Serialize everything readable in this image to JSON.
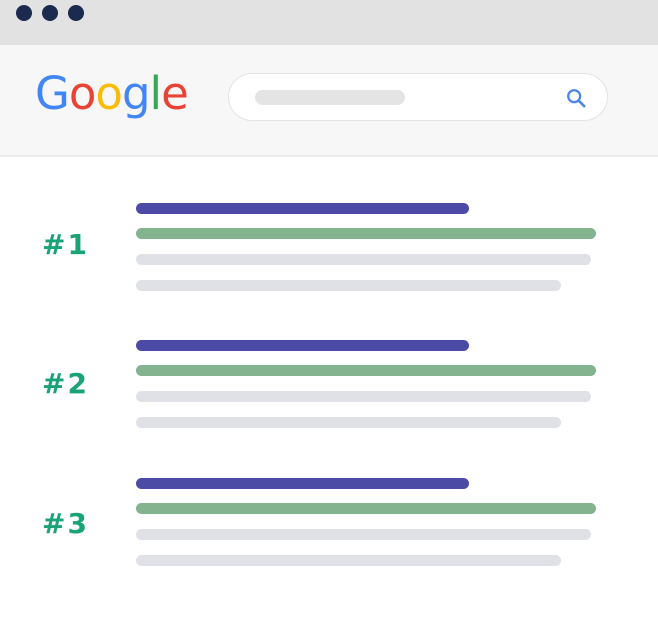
{
  "window": {
    "traffic_lights": [
      "dot",
      "dot",
      "dot"
    ],
    "dot_color": "#1b2a4e",
    "titlebar_color": "#e2e2e2"
  },
  "header": {
    "logo": {
      "letters": [
        "G",
        "o",
        "o",
        "g",
        "l",
        "e"
      ],
      "colors": [
        "#4285F4",
        "#EA4335",
        "#FBBC05",
        "#4285F4",
        "#34A853",
        "#EA4335"
      ]
    },
    "search": {
      "icon": "search-icon",
      "icon_color": "#4a86e8"
    }
  },
  "results": [
    {
      "rank": "#1"
    },
    {
      "rank": "#2"
    },
    {
      "rank": "#3"
    }
  ],
  "colors": {
    "rank_text": "#1aa377",
    "title_line": "#4b4ba6",
    "url_line": "#83b38f",
    "snippet_line": "#e0e1e6"
  }
}
